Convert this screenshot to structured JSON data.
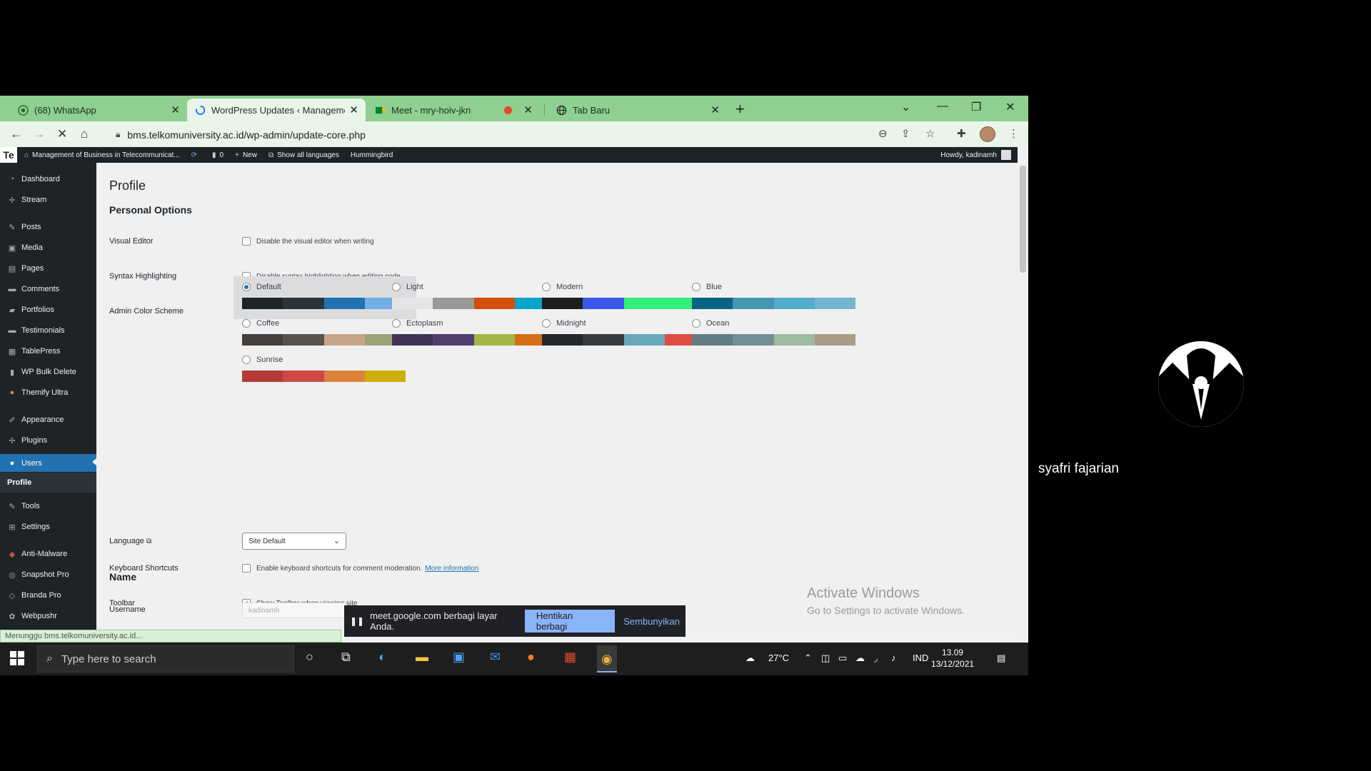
{
  "browser": {
    "tabs": [
      {
        "title": "(68) WhatsApp",
        "icon": "whatsapp-icon",
        "active": false
      },
      {
        "title": "WordPress Updates ‹ Management",
        "icon": "loading-spinner-icon",
        "active": true
      },
      {
        "title": "Meet - mry-hoiv-jkn",
        "icon": "meet-icon",
        "active": false
      },
      {
        "title": "Tab Baru",
        "icon": "globe-icon",
        "active": false
      }
    ],
    "url": "bms.telkomuniversity.ac.id/wp-admin/update-core.php",
    "status_text": "Menunggu bms.telkomuniversity.ac.id..."
  },
  "adminbar": {
    "logo": "Te",
    "site_name": "Management of Business in Telecommunicat...",
    "comments_count": "0",
    "new_label": "New",
    "languages_label": "Show all languages",
    "hummingbird_label": "Hummingbird",
    "howdy": "Howdy, kadinamh"
  },
  "sidebar": {
    "items": [
      {
        "label": "Dashboard",
        "icon": "dashboard-icon"
      },
      {
        "label": "Stream",
        "icon": "stream-icon"
      },
      {
        "label": "Posts",
        "icon": "pin-icon"
      },
      {
        "label": "Media",
        "icon": "media-icon"
      },
      {
        "label": "Pages",
        "icon": "page-icon"
      },
      {
        "label": "Comments",
        "icon": "comment-icon"
      },
      {
        "label": "Portfolios",
        "icon": "folder-icon"
      },
      {
        "label": "Testimonials",
        "icon": "testimonial-icon"
      },
      {
        "label": "TablePress",
        "icon": "table-icon"
      },
      {
        "label": "WP Bulk Delete",
        "icon": "trash-icon"
      },
      {
        "label": "Themify Ultra",
        "icon": "themify-icon"
      },
      {
        "label": "Appearance",
        "icon": "brush-icon"
      },
      {
        "label": "Plugins",
        "icon": "plugin-icon"
      },
      {
        "label": "Users",
        "icon": "user-icon"
      },
      {
        "label": "Profile",
        "icon": ""
      },
      {
        "label": "Tools",
        "icon": "wrench-icon"
      },
      {
        "label": "Settings",
        "icon": "settings-icon"
      },
      {
        "label": "Anti-Malware",
        "icon": "shield-icon"
      },
      {
        "label": "Snapshot Pro",
        "icon": "snapshot-icon"
      },
      {
        "label": "Branda Pro",
        "icon": "branda-icon"
      },
      {
        "label": "Webpushr",
        "icon": "bell-icon"
      }
    ]
  },
  "profile": {
    "page_title": "Profile",
    "personal_options": "Personal Options",
    "visual_editor_label": "Visual Editor",
    "visual_editor_text": "Disable the visual editor when writing",
    "syntax_label": "Syntax Highlighting",
    "syntax_text": "Disable syntax highlighting when editing code",
    "color_scheme_label": "Admin Color Scheme",
    "schemes": [
      {
        "name": "Default",
        "selected": true,
        "colors": [
          "#1d2327",
          "#2c3338",
          "#2271b1",
          "#72aee6"
        ]
      },
      {
        "name": "Light",
        "selected": false,
        "colors": [
          "#e5e5e5",
          "#999999",
          "#d64e07",
          "#04a4cc"
        ]
      },
      {
        "name": "Modern",
        "selected": false,
        "colors": [
          "#1e1e1e",
          "#3858e9",
          "#33f078",
          "#33f078"
        ]
      },
      {
        "name": "Blue",
        "selected": false,
        "colors": [
          "#096484",
          "#4796b3",
          "#52accc",
          "#74b6ce"
        ]
      },
      {
        "name": "Coffee",
        "selected": false,
        "colors": [
          "#46403c",
          "#59524c",
          "#c7a589",
          "#9ea476"
        ]
      },
      {
        "name": "Ectoplasm",
        "selected": false,
        "colors": [
          "#413256",
          "#523f6d",
          "#a3b745",
          "#d46f15"
        ]
      },
      {
        "name": "Midnight",
        "selected": false,
        "colors": [
          "#25282b",
          "#363b3f",
          "#69a8bb",
          "#e14d43"
        ]
      },
      {
        "name": "Ocean",
        "selected": false,
        "colors": [
          "#627c83",
          "#738e96",
          "#9ebaa0",
          "#aa9d88"
        ]
      },
      {
        "name": "Sunrise",
        "selected": false,
        "colors": [
          "#b43c38",
          "#cf4944",
          "#dd823b",
          "#ccaf0b"
        ]
      }
    ],
    "keyboard_label": "Keyboard Shortcuts",
    "keyboard_text": "Enable keyboard shortcuts for comment moderation.",
    "keyboard_link": "More information",
    "toolbar_label": "Toolbar",
    "toolbar_text": "Show Toolbar when viewing site",
    "language_label": "Language",
    "language_value": "Site Default",
    "name_heading": "Name",
    "username_label": "Username",
    "username_value": "kadinamh"
  },
  "windows_notice": {
    "line1": "Activate Windows",
    "line2": "Go to Settings to activate Windows."
  },
  "share_bar": {
    "text": "meet.google.com berbagi layar Anda.",
    "stop_label": "Hentikan berbagi",
    "hide_label": "Sembunyikan"
  },
  "taskbar": {
    "search_placeholder": "Type here to search",
    "temperature": "27°C",
    "language": "IND",
    "time": "13.09",
    "date": "13/12/2021"
  },
  "participant": {
    "name": "syafri fajarian"
  },
  "colors": {
    "tabstrip": "#8fcf8f",
    "wp_sidebar": "#1d2327",
    "wp_accent": "#2271b1",
    "meet_blue": "#8ab4f8"
  }
}
